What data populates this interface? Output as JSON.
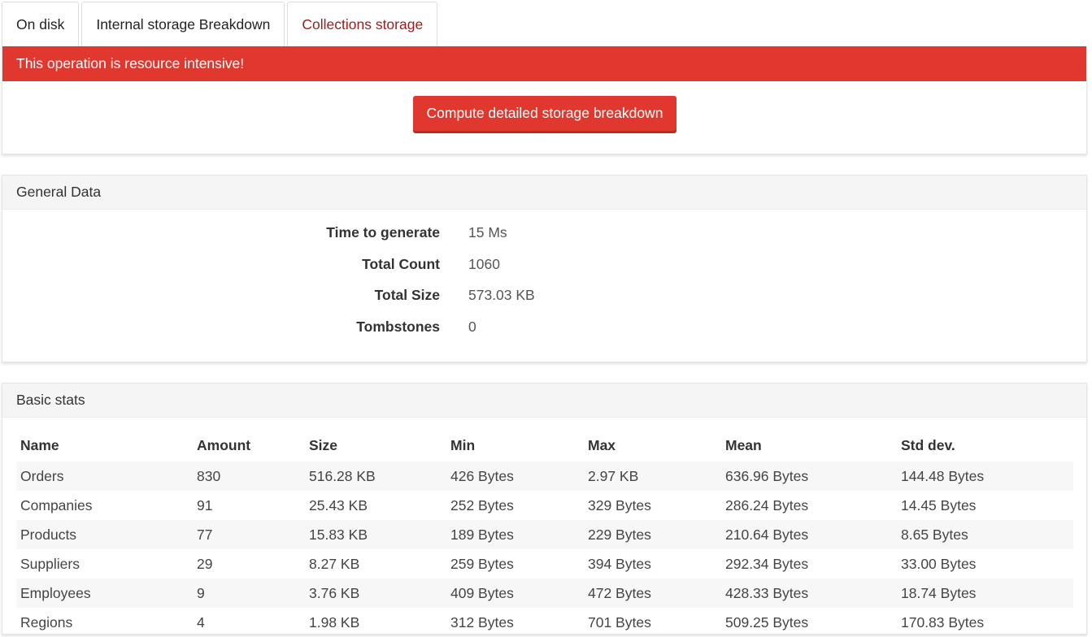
{
  "tabs": [
    {
      "label": "On disk",
      "active": false
    },
    {
      "label": "Internal storage Breakdown",
      "active": false
    },
    {
      "label": "Collections storage",
      "active": true
    }
  ],
  "alert": {
    "message": "This operation is resource intensive!",
    "button_label": "Compute detailed storage breakdown"
  },
  "general": {
    "title": "General Data",
    "rows": [
      {
        "label": "Time to generate",
        "value": "15 Ms"
      },
      {
        "label": "Total Count",
        "value": "1060"
      },
      {
        "label": "Total Size",
        "value": "573.03 KB"
      },
      {
        "label": "Tombstones",
        "value": "0"
      }
    ]
  },
  "basic": {
    "title": "Basic stats",
    "columns": [
      "Name",
      "Amount",
      "Size",
      "Min",
      "Max",
      "Mean",
      "Std dev."
    ],
    "rows": [
      [
        "Orders",
        "830",
        "516.28 KB",
        "426 Bytes",
        "2.97 KB",
        "636.96 Bytes",
        "144.48 Bytes"
      ],
      [
        "Companies",
        "91",
        "25.43 KB",
        "252 Bytes",
        "329 Bytes",
        "286.24 Bytes",
        "14.45 Bytes"
      ],
      [
        "Products",
        "77",
        "15.83 KB",
        "189 Bytes",
        "229 Bytes",
        "210.64 Bytes",
        "8.65 Bytes"
      ],
      [
        "Suppliers",
        "29",
        "8.27 KB",
        "259 Bytes",
        "394 Bytes",
        "292.34 Bytes",
        "33.00 Bytes"
      ],
      [
        "Employees",
        "9",
        "3.76 KB",
        "409 Bytes",
        "472 Bytes",
        "428.33 Bytes",
        "18.74 Bytes"
      ],
      [
        "Regions",
        "4",
        "1.98 KB",
        "312 Bytes",
        "701 Bytes",
        "509.25 Bytes",
        "170.83 Bytes"
      ]
    ]
  },
  "colors": {
    "danger": "#e0382e",
    "active_tab": "#9b1c1c"
  }
}
